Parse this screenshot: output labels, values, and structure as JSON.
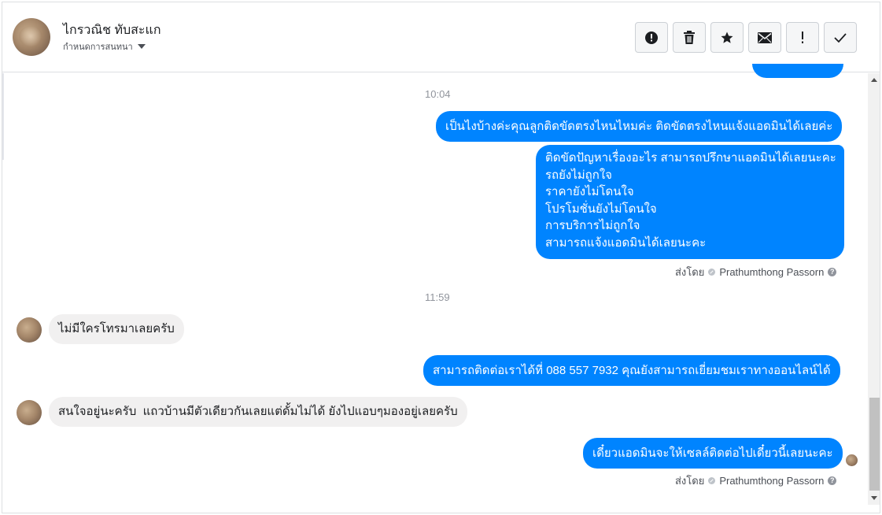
{
  "header": {
    "contact_name": "ไกรวณิช ทับสะแก",
    "assign_label": "กำหนดการสนทนา"
  },
  "actions": [
    {
      "icon": "alert-circle-icon",
      "name": "mark-spam-button"
    },
    {
      "icon": "trash-icon",
      "name": "delete-button"
    },
    {
      "icon": "star-icon",
      "name": "star-button"
    },
    {
      "icon": "envelope-icon",
      "name": "mark-unread-button"
    },
    {
      "icon": "exclamation-icon",
      "name": "follow-up-button"
    },
    {
      "icon": "checkmark-icon",
      "name": "mark-done-button"
    }
  ],
  "messages": {
    "time1": "10:04",
    "out1": "เป็นไงบ้างค่ะคุณลูกติดขัดตรงไหนไหมค่ะ ติดขัดตรงไหนแจ้งแอดมินได้เลยค่ะ",
    "out2": "ติดขัดปัญหาเรื่องอะไร สามารถปรึกษาแอดมินได้เลยนะคะ\nรถยังไม่ถูกใจ\nราคายังไม่โดนใจ\nโปรโมชั่นยังไม่โดนใจ\nการบริการไม่ถูกใจ\nสามารถแจ้งแอดมินได้เลยนะคะ",
    "sent_by_label": "ส่งโดย",
    "agent_name": "Prathumthong Passorn",
    "help_glyph": "?",
    "time2": "11:59",
    "in1": "ไม่มีใครโทรมาเลยครับ",
    "out3": "สามารถติดต่อเราได้ที่ 088 557 7932 คุณยังสามารถเยี่ยมชมเราทางออนไลน์ได้",
    "in2": "สนใจอยู่นะครับ  แถวบ้านมีตัวเดียวกันเลยแต่ดั้มไม่ได้ ยังไปแอบๆมองอยู่เลยครับ",
    "out4": "เดี๋ยวแอดมินจะให้เซลล์ติดต่อไปเดี๋ยวนี้เลยนะคะ"
  },
  "colors": {
    "outgoing_bubble": "#0084ff",
    "incoming_bubble": "#f1f0f0",
    "meta_text": "#90949c"
  }
}
